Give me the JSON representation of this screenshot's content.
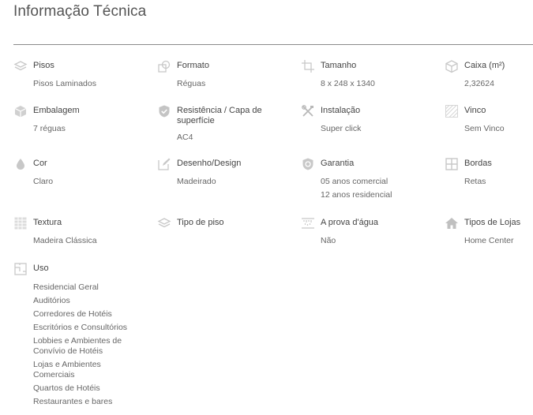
{
  "page_title": "Informação Técnica",
  "specs": {
    "pisos": {
      "label": "Pisos",
      "values": [
        "Pisos Laminados"
      ]
    },
    "formato": {
      "label": "Formato",
      "values": [
        "Réguas"
      ]
    },
    "tamanho": {
      "label": "Tamanho",
      "values": [
        "8 x 248 x 1340"
      ]
    },
    "caixa": {
      "label": "Caixa (m²)",
      "values": [
        "2,32624"
      ]
    },
    "embalagem": {
      "label": "Embalagem",
      "values": [
        "7 réguas"
      ]
    },
    "resistencia": {
      "label": "Resistência / Capa de superfície",
      "values": [
        "AC4"
      ]
    },
    "instalacao": {
      "label": "Instalação",
      "values": [
        "Super click"
      ]
    },
    "vinco": {
      "label": "Vinco",
      "values": [
        "Sem Vinco"
      ]
    },
    "cor": {
      "label": "Cor",
      "values": [
        "Claro"
      ]
    },
    "desenho": {
      "label": "Desenho/Design",
      "values": [
        "Madeirado"
      ]
    },
    "garantia": {
      "label": "Garantia",
      "values": [
        "05 anos comercial",
        "12 anos residencial"
      ]
    },
    "bordas": {
      "label": "Bordas",
      "values": [
        "Retas"
      ]
    },
    "textura": {
      "label": "Textura",
      "values": [
        "Madeira Clássica"
      ]
    },
    "tipo_piso": {
      "label": "Tipo de piso",
      "values": []
    },
    "prova_agua": {
      "label": "A prova d'água",
      "values": [
        "Não"
      ]
    },
    "tipos_lojas": {
      "label": "Tipos de Lojas",
      "values": [
        "Home Center"
      ]
    },
    "uso": {
      "label": "Uso",
      "values": [
        "Residencial Geral",
        "Auditórios",
        "Corredores de Hotéis",
        "Escritórios e Consultórios",
        "Lobbies e Ambientes de Convívio de Hotéis",
        "Lojas e Ambientes Comerciais",
        "Quartos de Hotéis",
        "Restaurantes e bares"
      ]
    }
  }
}
